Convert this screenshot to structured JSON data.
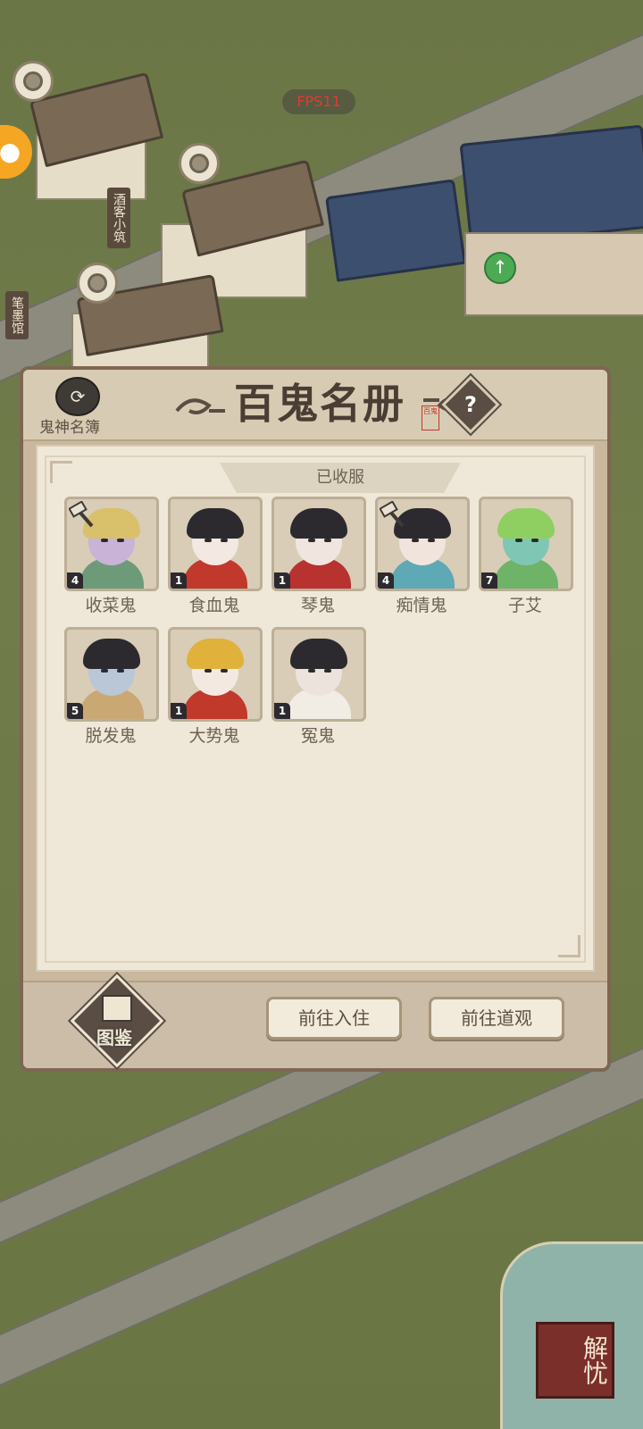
{
  "hud": {
    "fps": "FPS11"
  },
  "world": {
    "signs": {
      "tavern": "酒客小筑",
      "brush_hall": "笔墨馆"
    },
    "corner_seal": "解忧"
  },
  "dialog": {
    "title": "百鬼名册",
    "title_seal": "百鬼",
    "roster_label": "鬼神名簿",
    "section_label": "已收服",
    "ghosts": [
      {
        "name": "收菜鬼",
        "level": "4",
        "upgrade": true,
        "skin": "#c9b3d6",
        "hair": "#d9c06a",
        "body": "#6d9b7a"
      },
      {
        "name": "食血鬼",
        "level": "1",
        "upgrade": false,
        "skin": "#f3e8e2",
        "hair": "#2c2a2e",
        "body": "#c0392b"
      },
      {
        "name": "琴鬼",
        "level": "1",
        "upgrade": false,
        "skin": "#f1e6df",
        "hair": "#2c2a2e",
        "body": "#b8322f"
      },
      {
        "name": "痴情鬼",
        "level": "4",
        "upgrade": true,
        "skin": "#f1e4dc",
        "hair": "#2c2a2e",
        "body": "#5fa8b5"
      },
      {
        "name": "子艾",
        "level": "7",
        "upgrade": false,
        "skin": "#7fc7b4",
        "hair": "#8fcf62",
        "body": "#6fb368"
      },
      {
        "name": "脱发鬼",
        "level": "5",
        "upgrade": false,
        "skin": "#b9c7d6",
        "hair": "#2c2a2e",
        "body": "#caa874"
      },
      {
        "name": "大势鬼",
        "level": "1",
        "upgrade": false,
        "skin": "#f4e9e0",
        "hair": "#e0b23c",
        "body": "#c0392b"
      },
      {
        "name": "冤鬼",
        "level": "1",
        "upgrade": false,
        "skin": "#ece3dc",
        "hair": "#2c2a2e",
        "body": "#f2ede4"
      }
    ],
    "buttons": {
      "atlas": "图鉴",
      "go_residence": "前往入住",
      "go_temple": "前往道观"
    }
  }
}
